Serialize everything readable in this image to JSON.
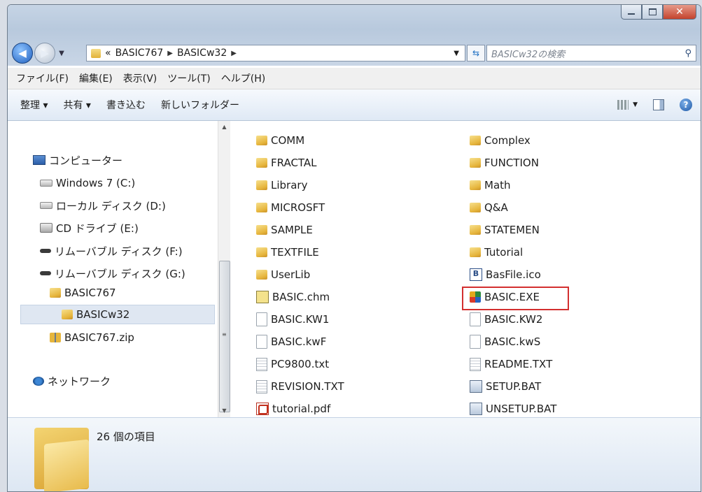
{
  "window": {
    "caption_buttons": [
      "minimize",
      "maximize",
      "close"
    ]
  },
  "nav": {
    "breadcrumb": [
      "«",
      "BASIC767",
      "BASICw32"
    ],
    "search_placeholder": "BASICw32の検索"
  },
  "menu": [
    "ファイル(F)",
    "編集(E)",
    "表示(V)",
    "ツール(T)",
    "ヘルプ(H)"
  ],
  "commands": [
    "整理 ▾",
    "共有 ▾",
    "書き込む",
    "新しいフォルダー"
  ],
  "tree": [
    {
      "label": "コンピューター",
      "icon": "computer-icon"
    },
    {
      "label": "Windows 7 (C:)",
      "icon": "drive-icon"
    },
    {
      "label": "ローカル ディスク (D:)",
      "icon": "drive-icon"
    },
    {
      "label": "CD ドライブ (E:)",
      "icon": "cd-drive-icon"
    },
    {
      "label": "リムーバブル ディスク (F:)",
      "icon": "removable-drive-icon"
    },
    {
      "label": "リムーバブル ディスク (G:)",
      "icon": "removable-drive-icon"
    },
    {
      "label": "BASIC767",
      "icon": "folder-icon"
    },
    {
      "label": "BASICw32",
      "icon": "folder-icon",
      "selected": true
    },
    {
      "label": "BASIC767.zip",
      "icon": "zip-folder-icon"
    },
    {
      "label": "ネットワーク",
      "icon": "network-icon"
    }
  ],
  "files_left": [
    {
      "name": "COMM",
      "type": "folder"
    },
    {
      "name": "FRACTAL",
      "type": "folder"
    },
    {
      "name": "Library",
      "type": "folder"
    },
    {
      "name": "MICROSFT",
      "type": "folder"
    },
    {
      "name": "SAMPLE",
      "type": "folder"
    },
    {
      "name": "TEXTFILE",
      "type": "folder"
    },
    {
      "name": "UserLib",
      "type": "folder"
    },
    {
      "name": "BASIC.chm",
      "type": "chm"
    },
    {
      "name": "BASIC.KW1",
      "type": "doc"
    },
    {
      "name": "BASIC.kwF",
      "type": "doc"
    },
    {
      "name": "PC9800.txt",
      "type": "txt"
    },
    {
      "name": "REVISION.TXT",
      "type": "txt"
    },
    {
      "name": "tutorial.pdf",
      "type": "pdf"
    }
  ],
  "files_right": [
    {
      "name": "Complex",
      "type": "folder"
    },
    {
      "name": "FUNCTION",
      "type": "folder"
    },
    {
      "name": "Math",
      "type": "folder"
    },
    {
      "name": "Q&A",
      "type": "folder"
    },
    {
      "name": "STATEMEN",
      "type": "folder"
    },
    {
      "name": "Tutorial",
      "type": "folder"
    },
    {
      "name": "BasFile.ico",
      "type": "ico"
    },
    {
      "name": "BASIC.EXE",
      "type": "exe",
      "highlighted": true
    },
    {
      "name": "BASIC.KW2",
      "type": "doc"
    },
    {
      "name": "BASIC.kwS",
      "type": "doc"
    },
    {
      "name": "README.TXT",
      "type": "txt"
    },
    {
      "name": "SETUP.BAT",
      "type": "bat"
    },
    {
      "name": "UNSETUP.BAT",
      "type": "bat"
    }
  ],
  "details": {
    "item_count": "26 個の項目"
  },
  "colors": {
    "highlight_box": "#d32f2f",
    "selected_bg": "#dfe7f2"
  }
}
